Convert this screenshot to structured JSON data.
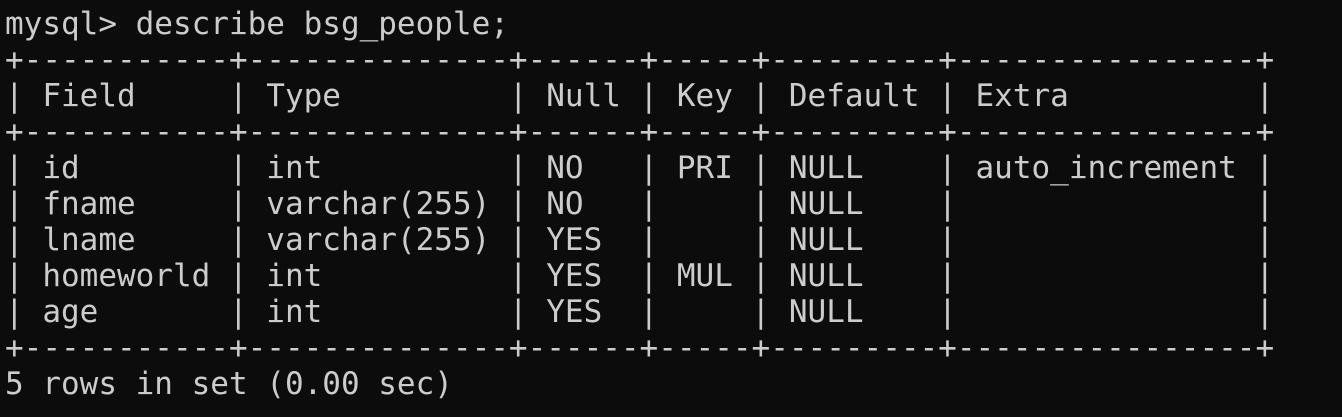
{
  "terminal": {
    "prompt": "mysql> describe bsg_people;",
    "table": {
      "border": "+-----------+--------------+------+-----+---------+----------------+",
      "header": "| Field     | Type         | Null | Key | Default | Extra          |",
      "rows": [
        "| id        | int          | NO   | PRI | NULL    | auto_increment |",
        "| fname     | varchar(255) | NO   |     | NULL    |                |",
        "| lname     | varchar(255) | YES  |     | NULL    |                |",
        "| homeworld | int          | YES  | MUL | NULL    |                |",
        "| age       | int          | YES  |     | NULL    |                |"
      ]
    },
    "footer": "5 rows in set (0.00 sec)"
  }
}
